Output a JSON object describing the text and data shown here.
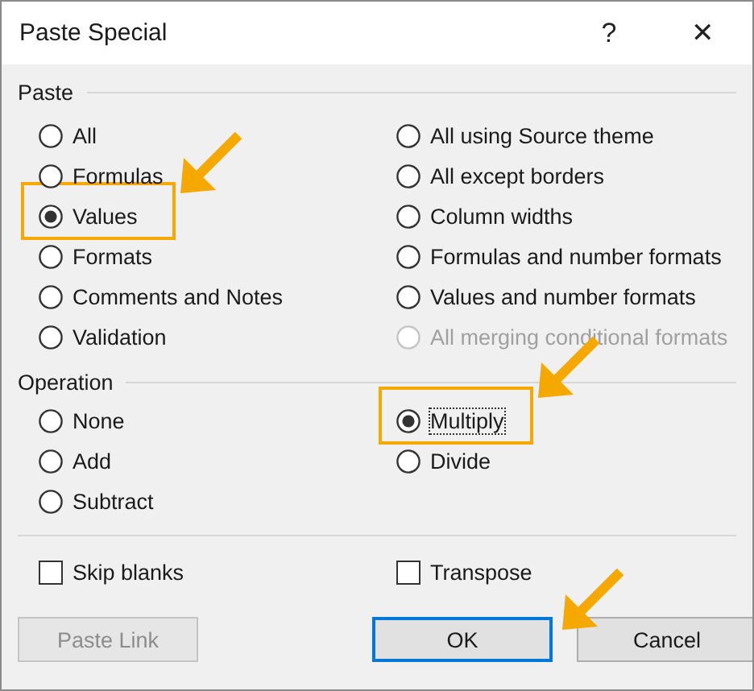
{
  "window": {
    "title": "Paste Special",
    "help": "?",
    "close": "✕"
  },
  "paste": {
    "label": "Paste",
    "columns": [
      [
        {
          "label": "All",
          "selected": false,
          "disabled": false,
          "focused": false,
          "highlighted": false,
          "arrow": false
        },
        {
          "label": "Formulas",
          "selected": false,
          "disabled": false,
          "focused": false,
          "highlighted": false,
          "arrow": false
        },
        {
          "label": "Values",
          "selected": true,
          "disabled": false,
          "focused": false,
          "highlighted": true,
          "arrow": true
        },
        {
          "label": "Formats",
          "selected": false,
          "disabled": false,
          "focused": false,
          "highlighted": false,
          "arrow": false
        },
        {
          "label": "Comments and Notes",
          "selected": false,
          "disabled": false,
          "focused": false,
          "highlighted": false,
          "arrow": false
        },
        {
          "label": "Validation",
          "selected": false,
          "disabled": false,
          "focused": false,
          "highlighted": false,
          "arrow": false
        }
      ],
      [
        {
          "label": "All using Source theme",
          "selected": false,
          "disabled": false,
          "focused": false,
          "highlighted": false,
          "arrow": false
        },
        {
          "label": "All except borders",
          "selected": false,
          "disabled": false,
          "focused": false,
          "highlighted": false,
          "arrow": false
        },
        {
          "label": "Column widths",
          "selected": false,
          "disabled": false,
          "focused": false,
          "highlighted": false,
          "arrow": false
        },
        {
          "label": "Formulas and number formats",
          "selected": false,
          "disabled": false,
          "focused": false,
          "highlighted": false,
          "arrow": false
        },
        {
          "label": "Values and number formats",
          "selected": false,
          "disabled": false,
          "focused": false,
          "highlighted": false,
          "arrow": false
        },
        {
          "label": "All merging conditional formats",
          "selected": false,
          "disabled": true,
          "focused": false,
          "highlighted": false,
          "arrow": false
        }
      ]
    ]
  },
  "operation": {
    "label": "Operation",
    "columns": [
      [
        {
          "label": "None",
          "selected": false,
          "disabled": false,
          "focused": false,
          "highlighted": false,
          "arrow": false
        },
        {
          "label": "Add",
          "selected": false,
          "disabled": false,
          "focused": false,
          "highlighted": false,
          "arrow": false
        },
        {
          "label": "Subtract",
          "selected": false,
          "disabled": false,
          "focused": false,
          "highlighted": false,
          "arrow": false
        }
      ],
      [
        {
          "label": "Multiply",
          "selected": true,
          "disabled": false,
          "focused": true,
          "highlighted": true,
          "arrow": true
        },
        {
          "label": "Divide",
          "selected": false,
          "disabled": false,
          "focused": false,
          "highlighted": false,
          "arrow": false
        }
      ]
    ]
  },
  "checkboxes": [
    {
      "label": "Skip blanks",
      "checked": false
    },
    {
      "label": "Transpose",
      "checked": false
    }
  ],
  "buttons": [
    {
      "label": "Paste Link",
      "disabled": true,
      "default": false,
      "arrow": false
    },
    {
      "label": "OK",
      "disabled": false,
      "default": true,
      "arrow": true
    },
    {
      "label": "Cancel",
      "disabled": false,
      "default": false,
      "arrow": false
    }
  ]
}
